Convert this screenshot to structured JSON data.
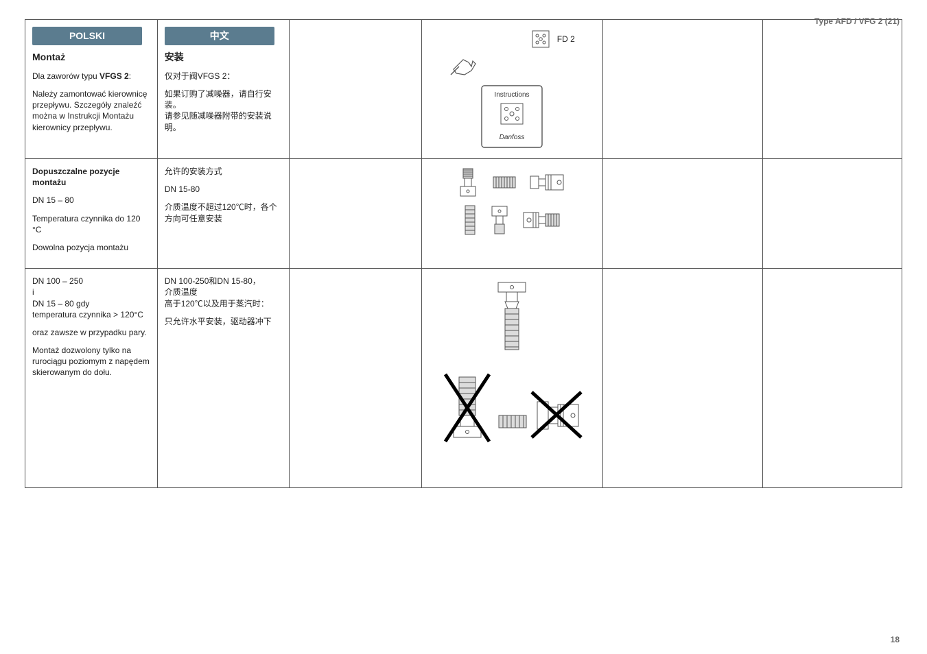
{
  "page": {
    "type_label": "Type AFD / VFG 2 (21)",
    "page_number": "18"
  },
  "col1": {
    "header": "POLSKI",
    "row1": {
      "title": "Montaż",
      "line1_pre": "Dla zaworów typu ",
      "line1_bold": "VFGS 2",
      "line1_post": ":",
      "para": "Należy zamontować kierownicę przepływu. Szczegóły znaleźć można w Instrukcji Montażu kierownicy przepływu."
    },
    "row2": {
      "title": "Dopuszczalne pozycje montażu",
      "line1": "DN 15 – 80",
      "line2": "Temperatura czynnika do 120 °C",
      "line3": "Dowolna pozycja montażu"
    },
    "row3": {
      "l1": "DN 100 – 250",
      "l2": "i",
      "l3": "DN 15 – 80 gdy",
      "l4": "temperatura czynnika > 120°C",
      "l5": "oraz zawsze w przypadku pary.",
      "l6": "Montaż dozwolony tylko na rurociągu poziomym z napędem skierowanym do dołu."
    }
  },
  "col2": {
    "header": "中文",
    "row1": {
      "title": "安装",
      "line1": "仅对于阀VFGS 2：",
      "para": "如果订购了减噪器，请自行安装。\n请参见随减噪器附带的安装说明。"
    },
    "row2": {
      "title": "允许的安装方式",
      "line1": "DN 15-80",
      "line2": "介质温度不超过120℃时，各个方向可任意安装"
    },
    "row3": {
      "l1": "DN 100-250和DN 15-80，",
      "l2": "介质温度",
      "l3": "高于120℃以及用于蒸汽时：",
      "l4": "只允许水平安装，驱动器冲下"
    }
  },
  "figures": {
    "fd2_label": "FD 2",
    "instructions_label": "Instructions",
    "brand": "Danfoss"
  }
}
